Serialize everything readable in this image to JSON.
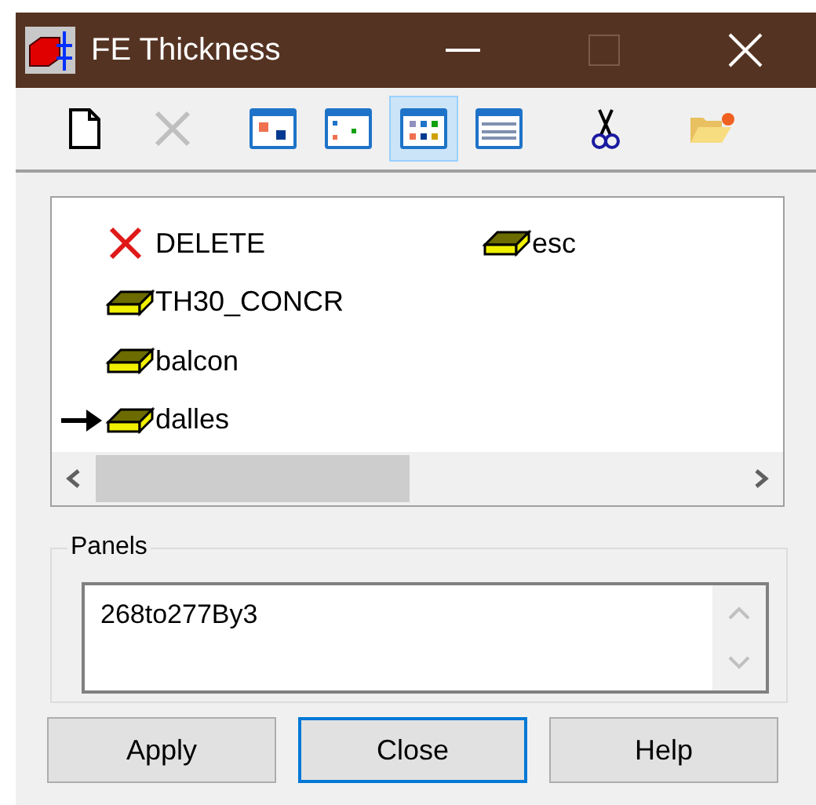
{
  "window": {
    "title": "FE Thickness"
  },
  "toolbar": [
    {
      "kind": "new",
      "selected": false,
      "disabled": false
    },
    {
      "kind": "delete",
      "selected": false,
      "disabled": true
    },
    {
      "kind": "large-icons",
      "selected": false,
      "disabled": false
    },
    {
      "kind": "small-icons",
      "selected": false,
      "disabled": false
    },
    {
      "kind": "list",
      "selected": true,
      "disabled": false
    },
    {
      "kind": "details",
      "selected": false,
      "disabled": false
    },
    {
      "kind": "cut",
      "selected": false,
      "disabled": false
    },
    {
      "kind": "open",
      "selected": false,
      "disabled": false
    }
  ],
  "items": [
    {
      "label": "DELETE",
      "kind": "delete",
      "current": false
    },
    {
      "label": "TH30_CONCR",
      "kind": "thickness",
      "current": false
    },
    {
      "label": "balcon",
      "kind": "thickness",
      "current": false
    },
    {
      "label": "dalles",
      "kind": "thickness",
      "current": true
    },
    {
      "label": "esc",
      "kind": "thickness",
      "current": false
    }
  ],
  "panels": {
    "label": "Panels",
    "value": "268to277By3"
  },
  "buttons": [
    {
      "label": "Apply",
      "selected": false
    },
    {
      "label": "Close",
      "selected": true
    },
    {
      "label": "Help",
      "selected": false
    }
  ]
}
